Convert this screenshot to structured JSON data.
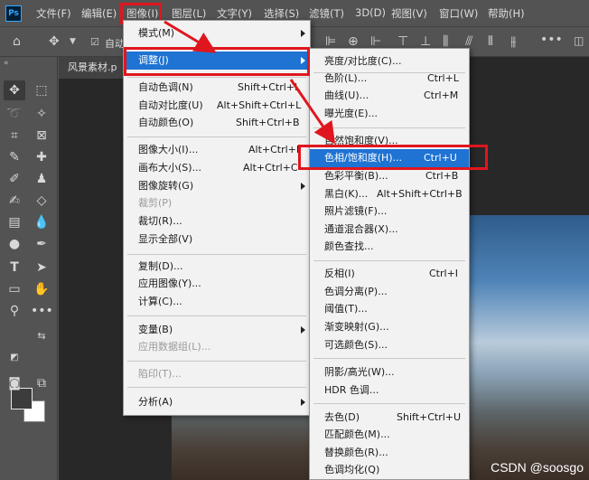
{
  "app": {
    "logo": "Ps"
  },
  "menubar": {
    "items": [
      "文件(F)",
      "编辑(E)",
      "图像(I)",
      "图层(L)",
      "文字(Y)",
      "选择(S)",
      "滤镜(T)",
      "3D(D)",
      "视图(V)",
      "窗口(W)",
      "帮助(H)"
    ]
  },
  "options": {
    "auto_label": "自动"
  },
  "document": {
    "tab_title": "风景素材.p"
  },
  "image_menu": {
    "items": [
      {
        "label": "模式(M)",
        "shortcut": "",
        "submenu": true,
        "disabled": false
      },
      {
        "label": "调整(J)",
        "shortcut": "",
        "submenu": true,
        "disabled": false,
        "highlighted": true
      },
      {
        "label": "自动色调(N)",
        "shortcut": "Shift+Ctrl+L",
        "submenu": false,
        "disabled": false
      },
      {
        "label": "自动对比度(U)",
        "shortcut": "Alt+Shift+Ctrl+L",
        "submenu": false,
        "disabled": false
      },
      {
        "label": "自动颜色(O)",
        "shortcut": "Shift+Ctrl+B",
        "submenu": false,
        "disabled": false
      },
      {
        "label": "图像大小(I)...",
        "shortcut": "Alt+Ctrl+I",
        "submenu": false,
        "disabled": false
      },
      {
        "label": "画布大小(S)...",
        "shortcut": "Alt+Ctrl+C",
        "submenu": false,
        "disabled": false
      },
      {
        "label": "图像旋转(G)",
        "shortcut": "",
        "submenu": true,
        "disabled": false
      },
      {
        "label": "裁剪(P)",
        "shortcut": "",
        "submenu": false,
        "disabled": true
      },
      {
        "label": "裁切(R)...",
        "shortcut": "",
        "submenu": false,
        "disabled": false
      },
      {
        "label": "显示全部(V)",
        "shortcut": "",
        "submenu": false,
        "disabled": false
      },
      {
        "label": "复制(D)...",
        "shortcut": "",
        "submenu": false,
        "disabled": false
      },
      {
        "label": "应用图像(Y)...",
        "shortcut": "",
        "submenu": false,
        "disabled": false
      },
      {
        "label": "计算(C)...",
        "shortcut": "",
        "submenu": false,
        "disabled": false
      },
      {
        "label": "变量(B)",
        "shortcut": "",
        "submenu": true,
        "disabled": false
      },
      {
        "label": "应用数据组(L)...",
        "shortcut": "",
        "submenu": false,
        "disabled": true
      },
      {
        "label": "陷印(T)...",
        "shortcut": "",
        "submenu": false,
        "disabled": true
      },
      {
        "label": "分析(A)",
        "shortcut": "",
        "submenu": true,
        "disabled": false
      }
    ]
  },
  "adjust_menu": {
    "items": [
      {
        "label": "亮度/对比度(C)...",
        "shortcut": ""
      },
      {
        "label": "色阶(L)...",
        "shortcut": "Ctrl+L"
      },
      {
        "label": "曲线(U)...",
        "shortcut": "Ctrl+M"
      },
      {
        "label": "曝光度(E)...",
        "shortcut": ""
      },
      {
        "label": "自然饱和度(V)...",
        "shortcut": ""
      },
      {
        "label": "色相/饱和度(H)...",
        "shortcut": "Ctrl+U",
        "highlighted": true
      },
      {
        "label": "色彩平衡(B)...",
        "shortcut": "Ctrl+B"
      },
      {
        "label": "黑白(K)...",
        "shortcut": "Alt+Shift+Ctrl+B"
      },
      {
        "label": "照片滤镜(F)...",
        "shortcut": ""
      },
      {
        "label": "通道混合器(X)...",
        "shortcut": ""
      },
      {
        "label": "颜色查找...",
        "shortcut": ""
      },
      {
        "label": "反相(I)",
        "shortcut": "Ctrl+I"
      },
      {
        "label": "色调分离(P)...",
        "shortcut": ""
      },
      {
        "label": "阈值(T)...",
        "shortcut": ""
      },
      {
        "label": "渐变映射(G)...",
        "shortcut": ""
      },
      {
        "label": "可选颜色(S)...",
        "shortcut": ""
      },
      {
        "label": "阴影/高光(W)...",
        "shortcut": ""
      },
      {
        "label": "HDR 色调...",
        "shortcut": ""
      },
      {
        "label": "去色(D)",
        "shortcut": "Shift+Ctrl+U"
      },
      {
        "label": "匹配颜色(M)...",
        "shortcut": ""
      },
      {
        "label": "替换颜色(R)...",
        "shortcut": ""
      },
      {
        "label": "色调均化(Q)",
        "shortcut": ""
      }
    ]
  },
  "watermark": "CSDN @soosgo",
  "colors": {
    "highlight": "#1e73d3",
    "annotation": "#e0161e",
    "panel": "#535353"
  }
}
